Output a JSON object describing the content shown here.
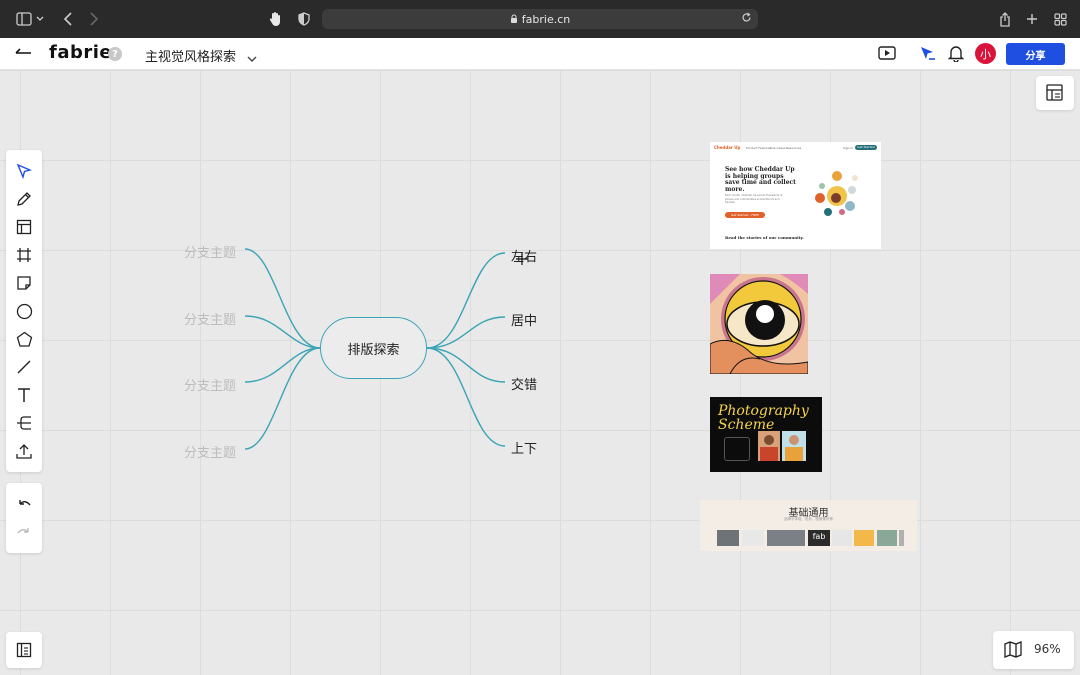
{
  "browser": {
    "url": "fabrie.cn"
  },
  "app": {
    "logo": "fabrie",
    "help": "?",
    "doc_title": "主视觉风格探索",
    "avatar_initial": "小",
    "share_label": "分享",
    "accent": "#1e4fe0",
    "avatar_color": "#d9143a"
  },
  "toolbar": {
    "tools": [
      "select-icon",
      "pen-icon",
      "layout-icon",
      "frame-icon",
      "sticky-note-icon",
      "circle-icon",
      "polygon-icon",
      "line-icon",
      "text-icon",
      "mindmap-icon",
      "upload-icon"
    ],
    "history": [
      "undo-icon",
      "redo-icon"
    ]
  },
  "mindmap": {
    "root": "排版探索",
    "left_branches": [
      "分支主题",
      "分支主题",
      "分支主题",
      "分支主题"
    ],
    "right_branches": [
      "左右",
      "居中",
      "交错",
      "上下"
    ],
    "line_color": "#3aa4b5"
  },
  "images": {
    "cheddar": {
      "brand": "Cheddar Up",
      "nav": [
        "Product Features",
        "Use Cases",
        "Resources"
      ],
      "login": "Sign in",
      "cta_nav": "Get Started",
      "headline": "See how Cheddar Up is helping groups save time and collect more.",
      "body": "Each month, Cheddar Up serves thousands of groups and communities across the US and Canada.",
      "cta": "Get Started - FREE",
      "footer": "Read the stories of our community."
    },
    "photo": {
      "title": "Photography Scheme"
    },
    "basic": {
      "title": "基础通用",
      "subtitle": "品牌字体组、色彩、图像素材等",
      "tag": "fab"
    }
  },
  "zoom": "96%"
}
